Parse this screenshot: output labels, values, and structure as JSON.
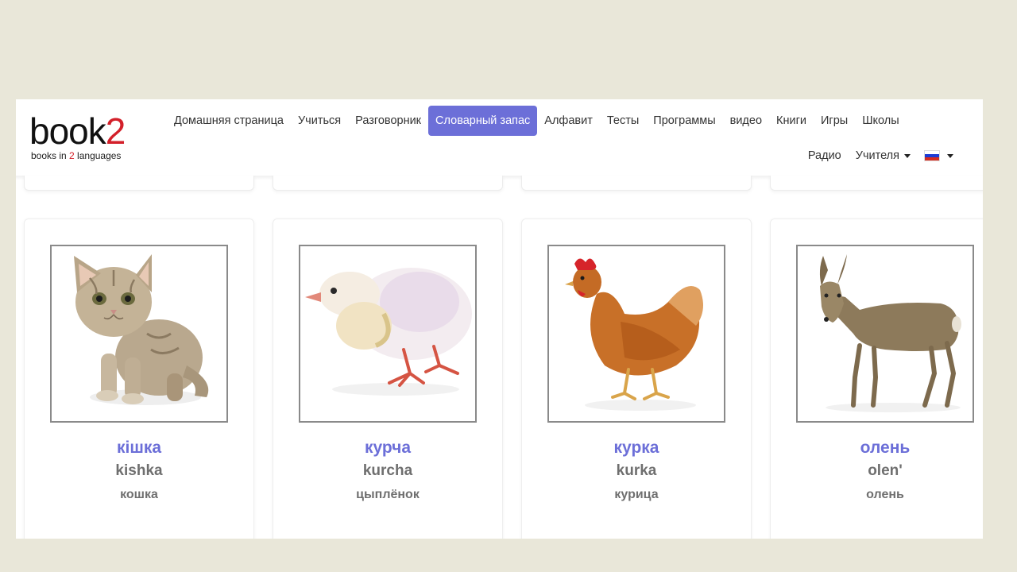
{
  "logo": {
    "word_start": "book",
    "word_accent": "2",
    "tag_start": "books in ",
    "tag_accent": "2",
    "tag_end": " languages"
  },
  "nav": {
    "row1": [
      "Домашняя страница",
      "Учиться",
      "Разговорник",
      "Словарный запас",
      "Алфавит",
      "Тесты",
      "Программы",
      "видео",
      "Книги",
      "Игры",
      "Школы"
    ],
    "active": "Словарный запас",
    "row2": {
      "radio": "Радио",
      "teachers": "Учителя",
      "language_flag": "ru-flag-icon"
    }
  },
  "cards": [
    {
      "native": "кішка",
      "transliteration": "kishka",
      "russian": "кошка",
      "image": "kitten"
    },
    {
      "native": "курча",
      "transliteration": "kurcha",
      "russian": "цыплёнок",
      "image": "chick"
    },
    {
      "native": "курка",
      "transliteration": "kurka",
      "russian": "курица",
      "image": "hen"
    },
    {
      "native": "олень",
      "transliteration": "olen'",
      "russian": "олень",
      "image": "deer"
    }
  ],
  "colors": {
    "accent": "#6c6fd8",
    "brand_red": "#d3202a",
    "backdrop": "#e9e7d9"
  }
}
